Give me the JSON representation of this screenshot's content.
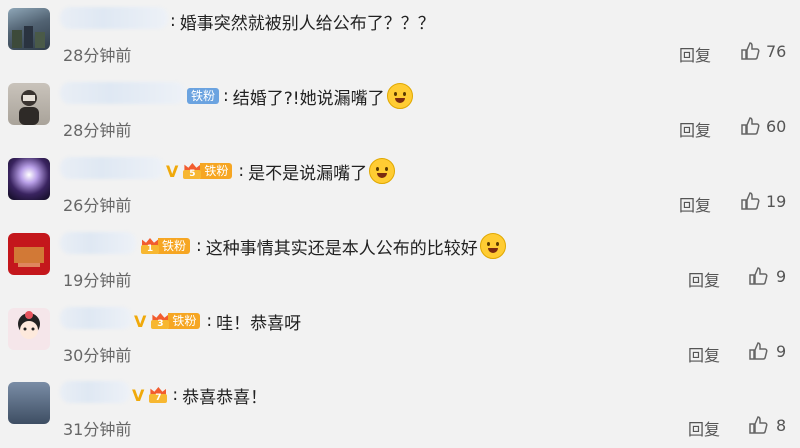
{
  "comments": [
    {
      "text": "婚事突然就被别人给公布了？？？",
      "time": "28分钟前",
      "reply": "回复",
      "likes": "76",
      "fan_badge": "",
      "level": ""
    },
    {
      "text": "结婚了?!她说漏嘴了",
      "time": "28分钟前",
      "reply": "回复",
      "likes": "60",
      "fan_badge": "铁粉",
      "level": ""
    },
    {
      "text": "是不是说漏嘴了",
      "time": "26分钟前",
      "reply": "回复",
      "likes": "19",
      "fan_badge": "铁粉",
      "level": "5",
      "vip": "V"
    },
    {
      "text": "这种事情其实还是本人公布的比较好",
      "time": "19分钟前",
      "reply": "回复",
      "likes": "9",
      "fan_badge": "铁粉",
      "level": "1"
    },
    {
      "text": "哇！恭喜呀",
      "time": "30分钟前",
      "reply": "回复",
      "likes": "9",
      "fan_badge": "铁粉",
      "level": "3",
      "vip": "V"
    },
    {
      "text": "恭喜恭喜！",
      "time": "31分钟前",
      "reply": "回复",
      "likes": "8",
      "fan_badge": "",
      "level": "7",
      "vip": "V"
    }
  ],
  "colors": {
    "background": "#f2f2f2",
    "fan_badge": "#6ba3e0",
    "crown_badge": "#f6a623",
    "vip": "#f0a90a"
  },
  "icons": {
    "like": "thumbs-up-icon",
    "emoji": "face-emoji-icon",
    "avatar": "user-avatar"
  }
}
